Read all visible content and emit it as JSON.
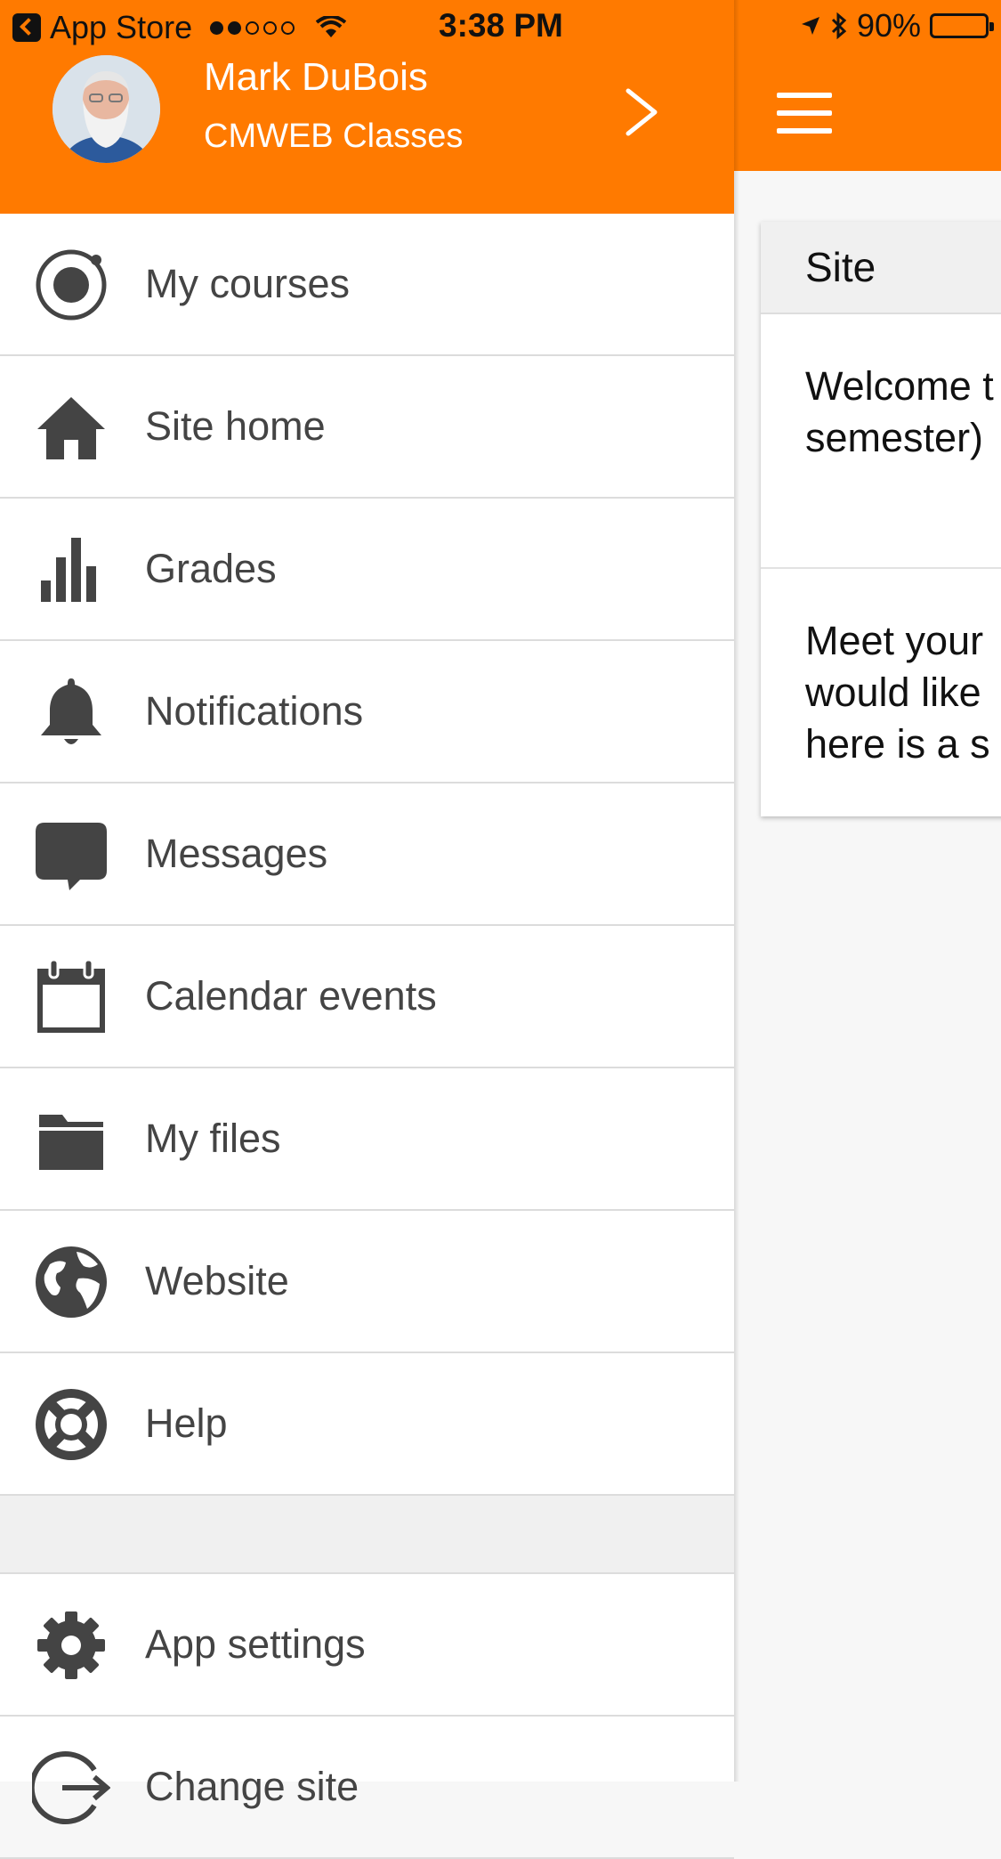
{
  "status_bar": {
    "back_app": "App Store",
    "time": "3:38 PM",
    "battery": "90%",
    "battery_level": 0.9,
    "signal_bars_filled": 2,
    "signal_bars_total": 5
  },
  "drawer": {
    "user_name": "Mark DuBois",
    "site_name": "CMWEB Classes",
    "menu": [
      {
        "label": "My courses",
        "icon": "target-icon"
      },
      {
        "label": "Site home",
        "icon": "home-icon"
      },
      {
        "label": "Grades",
        "icon": "bar-chart-icon"
      },
      {
        "label": "Notifications",
        "icon": "bell-icon"
      },
      {
        "label": "Messages",
        "icon": "chat-bubble-icon"
      },
      {
        "label": "Calendar events",
        "icon": "calendar-icon"
      },
      {
        "label": "My files",
        "icon": "folder-icon"
      },
      {
        "label": "Website",
        "icon": "globe-icon"
      },
      {
        "label": "Help",
        "icon": "lifebuoy-icon"
      }
    ],
    "menu_bottom": [
      {
        "label": "App settings",
        "icon": "gear-icon"
      },
      {
        "label": "Change site",
        "icon": "logout-icon"
      }
    ]
  },
  "content": {
    "card_title": "Site",
    "paragraph1": [
      "Welcome t",
      "semester)"
    ],
    "paragraph2": [
      "Meet your",
      "would like",
      "here is a s"
    ]
  },
  "colors": {
    "accent": "#FF7A00",
    "icon": "#444444",
    "divider": "#DCDCDC"
  }
}
